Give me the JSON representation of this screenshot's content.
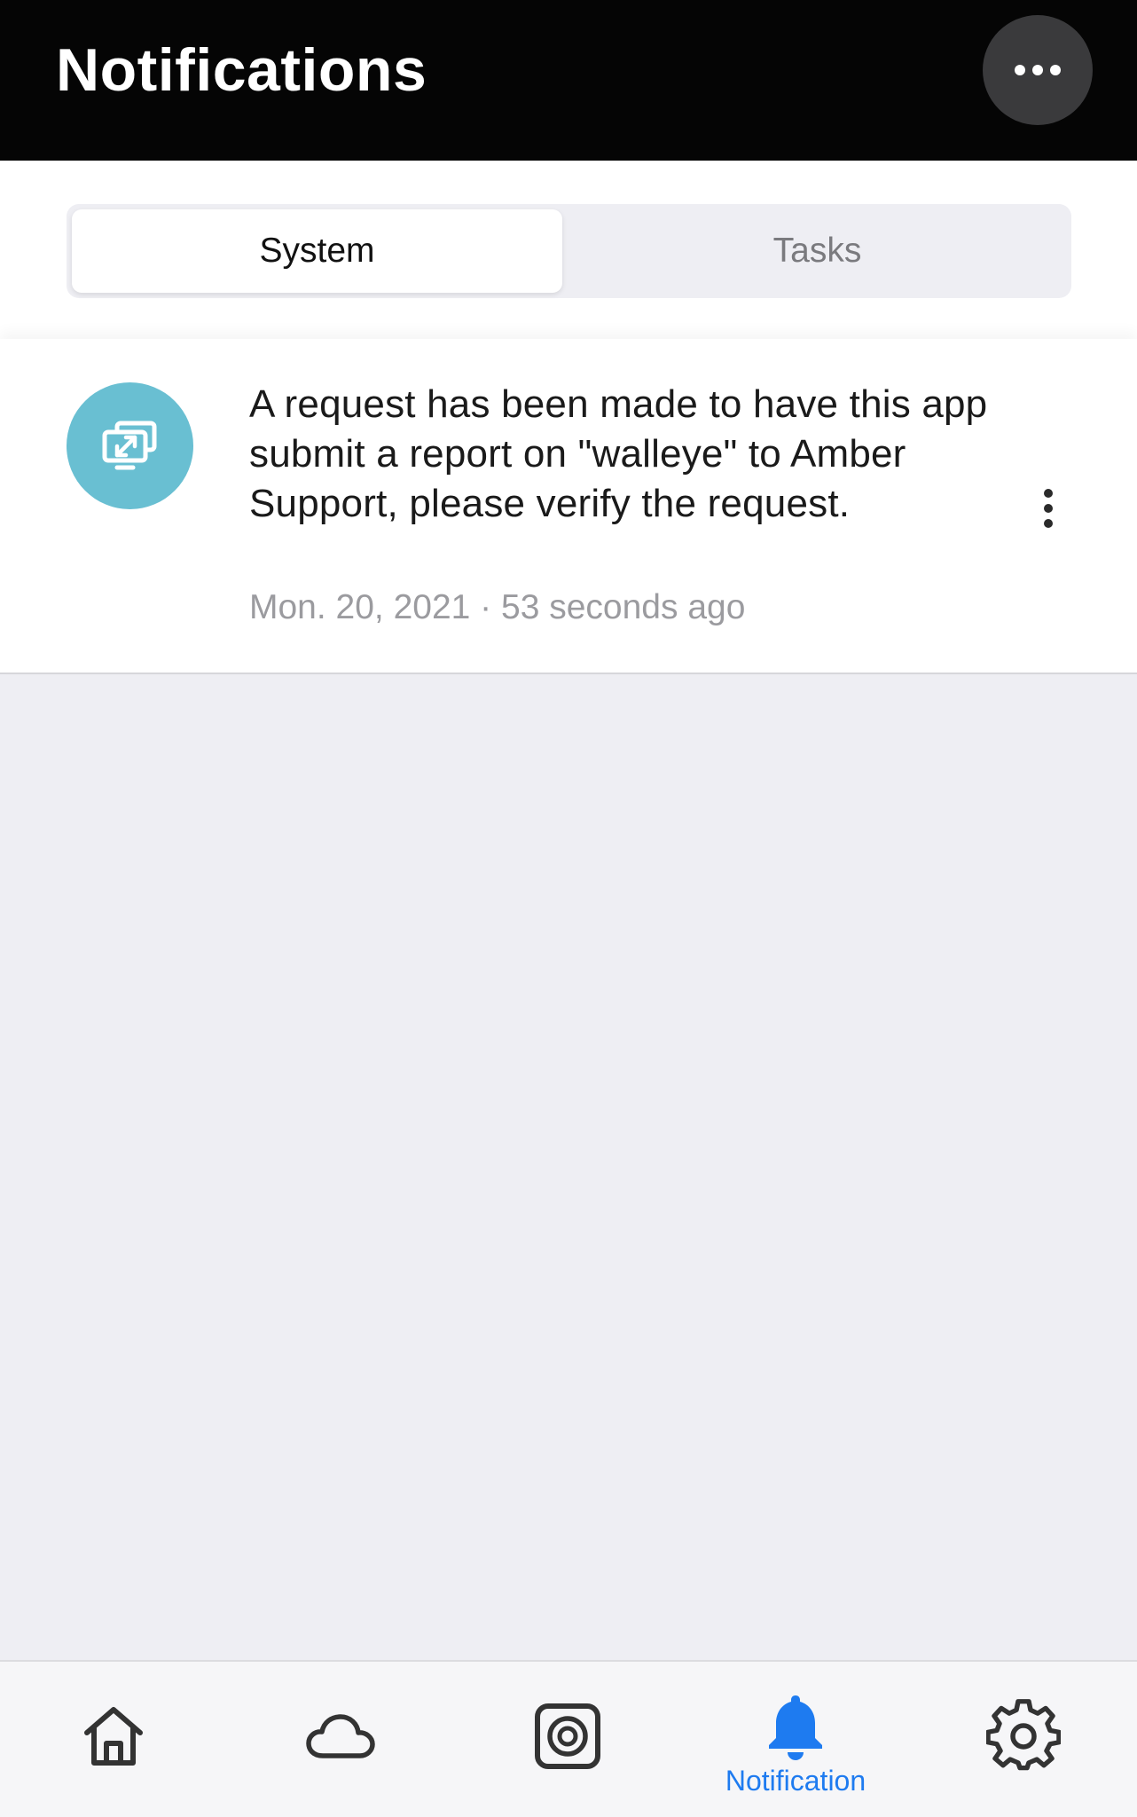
{
  "header": {
    "title": "Notifications",
    "more_icon": "more-horizontal-icon"
  },
  "tabs": [
    {
      "label": "System",
      "active": true
    },
    {
      "label": "Tasks",
      "active": false
    }
  ],
  "notifications": [
    {
      "icon": "remote-screen-icon",
      "icon_color": "#69bfd2",
      "message": "A request has been made to have this app submit a report on \"walleye\" to Amber Support, please verify the request.",
      "timestamp": "Mon. 20, 2021 · 53 seconds ago"
    }
  ],
  "bottom_nav": {
    "accent_color": "#1e7bf0",
    "items": [
      {
        "icon": "home-icon",
        "label": "",
        "active": false
      },
      {
        "icon": "cloud-icon",
        "label": "",
        "active": false
      },
      {
        "icon": "target-icon",
        "label": "",
        "active": false
      },
      {
        "icon": "bell-icon",
        "label": "Notification",
        "active": true
      },
      {
        "icon": "gear-icon",
        "label": "",
        "active": false
      }
    ]
  }
}
